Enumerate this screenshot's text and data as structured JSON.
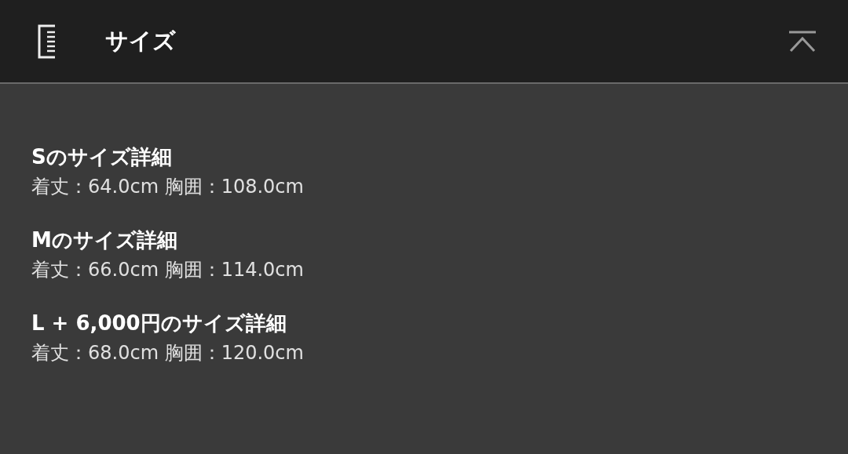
{
  "header": {
    "title": "サイズ"
  },
  "sizes": [
    {
      "title": "Sのサイズ詳細",
      "detail": "着丈：64.0cm 胸囲：108.0cm"
    },
    {
      "title": "Mのサイズ詳細",
      "detail": "着丈：66.0cm 胸囲：114.0cm"
    },
    {
      "title": "L + 6,000円のサイズ詳細",
      "detail": "着丈：68.0cm 胸囲：120.0cm"
    }
  ]
}
